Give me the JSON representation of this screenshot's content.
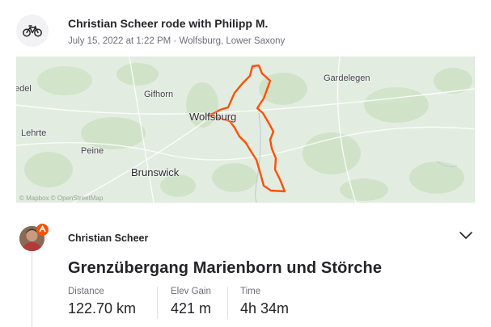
{
  "header": {
    "title": "Christian Scheer rode with Philipp M.",
    "meta": "July 15, 2022 at 1:22 PM · Wolfsburg, Lower Saxony"
  },
  "map": {
    "labels": {
      "edel": "edel",
      "gifhorn": "Gifhorn",
      "gardelegen": "Gardelegen",
      "lehrte": "Lehrte",
      "wolfsburg": "Wolfsburg",
      "peine": "Peine",
      "brunswick": "Brunswick"
    },
    "attribution": "© Mapbox © OpenStreetMap"
  },
  "activity": {
    "athlete": "Christian Scheer",
    "title": "Grenzübergang Marienborn und Störche",
    "stats": [
      {
        "label": "Distance",
        "value": "122.70 km"
      },
      {
        "label": "Elev Gain",
        "value": "421 m"
      },
      {
        "label": "Time",
        "value": "4h 34m"
      }
    ]
  },
  "colors": {
    "route": "#fc5200",
    "map_background": "#e3ece1",
    "text_primary": "#242428",
    "text_secondary": "#6d6d78"
  }
}
